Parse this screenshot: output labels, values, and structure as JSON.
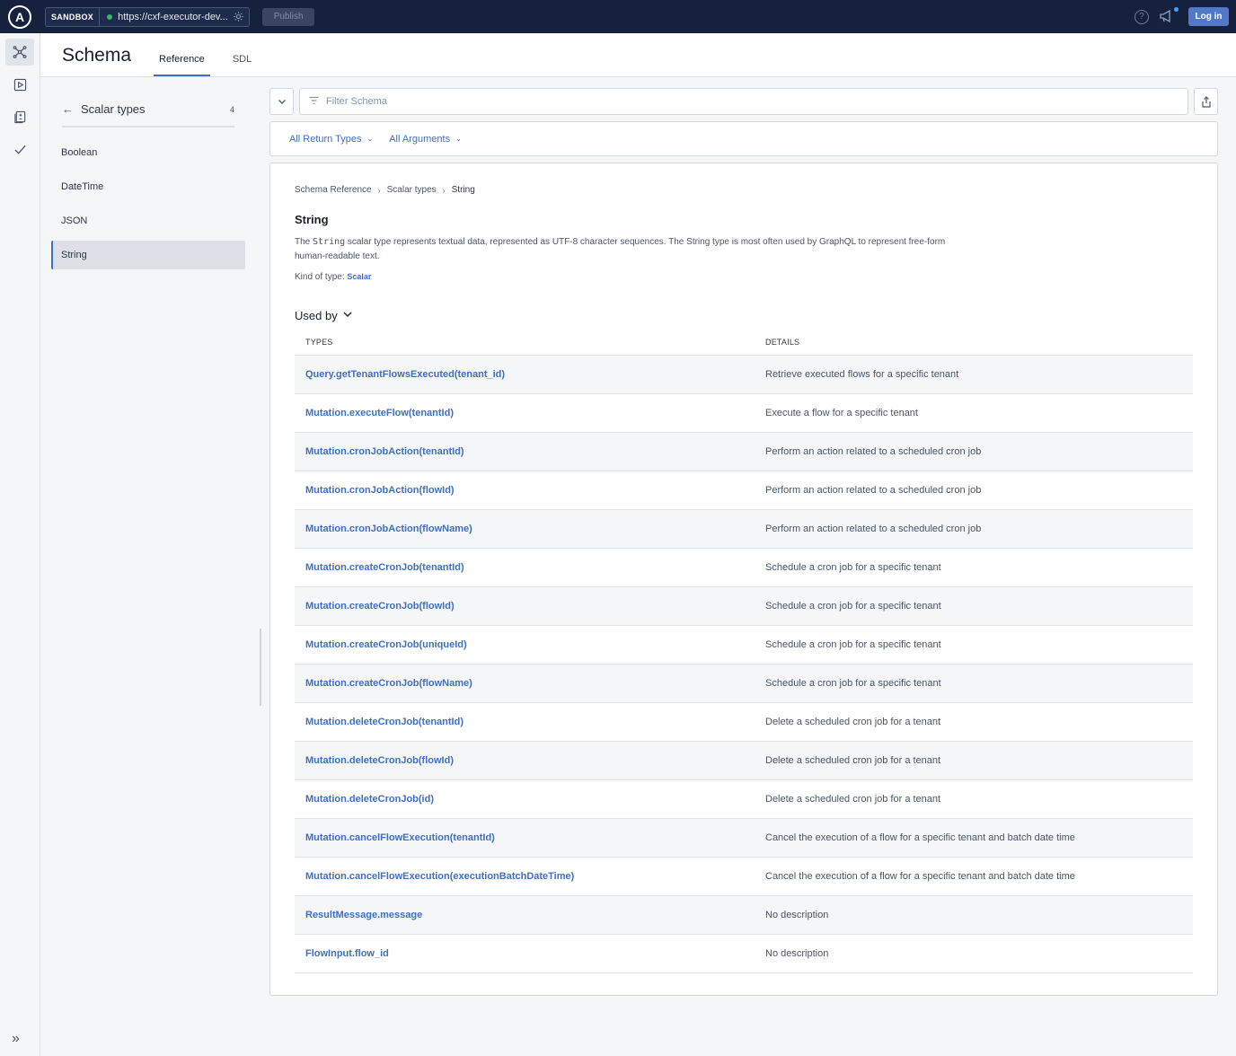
{
  "topbar": {
    "logo": "A",
    "sandbox_label": "SANDBOX",
    "url": "https://cxf-executor-dev....",
    "publish_label": "Publish",
    "login_label": "Log in"
  },
  "header": {
    "title": "Schema",
    "tabs": [
      {
        "label": "Reference"
      },
      {
        "label": "SDL"
      }
    ]
  },
  "sidebar": {
    "title": "Scalar types",
    "count": "4",
    "items": [
      {
        "label": "Boolean"
      },
      {
        "label": "DateTime"
      },
      {
        "label": "JSON"
      },
      {
        "label": "String"
      }
    ]
  },
  "filter": {
    "placeholder": "Filter Schema"
  },
  "options": {
    "return_types": "All Return Types",
    "arguments": "All Arguments"
  },
  "detail": {
    "breadcrumb": [
      "Schema Reference",
      "Scalar types",
      "String"
    ],
    "title": "String",
    "desc_prefix": "The ",
    "desc_code": "String",
    "desc_suffix": " scalar type represents textual data, represented as UTF-8 character sequences. The String type is most often used by GraphQL to represent free-form human-readable text.",
    "kind_label": "Kind of type: ",
    "kind_value": "Scalar",
    "used_by": "Used by",
    "col_types": "TYPES",
    "col_details": "DETAILS",
    "rows": [
      {
        "type": "Query.getTenantFlowsExecuted(tenant_id)",
        "details": "Retrieve executed flows for a specific tenant"
      },
      {
        "type": "Mutation.executeFlow(tenantId)",
        "details": "Execute a flow for a specific tenant"
      },
      {
        "type": "Mutation.cronJobAction(tenantId)",
        "details": "Perform an action related to a scheduled cron job"
      },
      {
        "type": "Mutation.cronJobAction(flowId)",
        "details": "Perform an action related to a scheduled cron job"
      },
      {
        "type": "Mutation.cronJobAction(flowName)",
        "details": "Perform an action related to a scheduled cron job"
      },
      {
        "type": "Mutation.createCronJob(tenantId)",
        "details": "Schedule a cron job for a specific tenant"
      },
      {
        "type": "Mutation.createCronJob(flowId)",
        "details": "Schedule a cron job for a specific tenant"
      },
      {
        "type": "Mutation.createCronJob(uniqueId)",
        "details": "Schedule a cron job for a specific tenant"
      },
      {
        "type": "Mutation.createCronJob(flowName)",
        "details": "Schedule a cron job for a specific tenant"
      },
      {
        "type": "Mutation.deleteCronJob(tenantId)",
        "details": "Delete a scheduled cron job for a tenant"
      },
      {
        "type": "Mutation.deleteCronJob(flowId)",
        "details": "Delete a scheduled cron job for a tenant"
      },
      {
        "type": "Mutation.deleteCronJob(id)",
        "details": "Delete a scheduled cron job for a tenant"
      },
      {
        "type": "Mutation.cancelFlowExecution(tenantId)",
        "details": "Cancel the execution of a flow for a specific tenant and batch date time"
      },
      {
        "type": "Mutation.cancelFlowExecution(executionBatchDateTime)",
        "details": "Cancel the execution of a flow for a specific tenant and batch date time"
      },
      {
        "type": "ResultMessage.message",
        "details": "No description"
      },
      {
        "type": "FlowInput.flow_id",
        "details": "No description"
      }
    ]
  }
}
